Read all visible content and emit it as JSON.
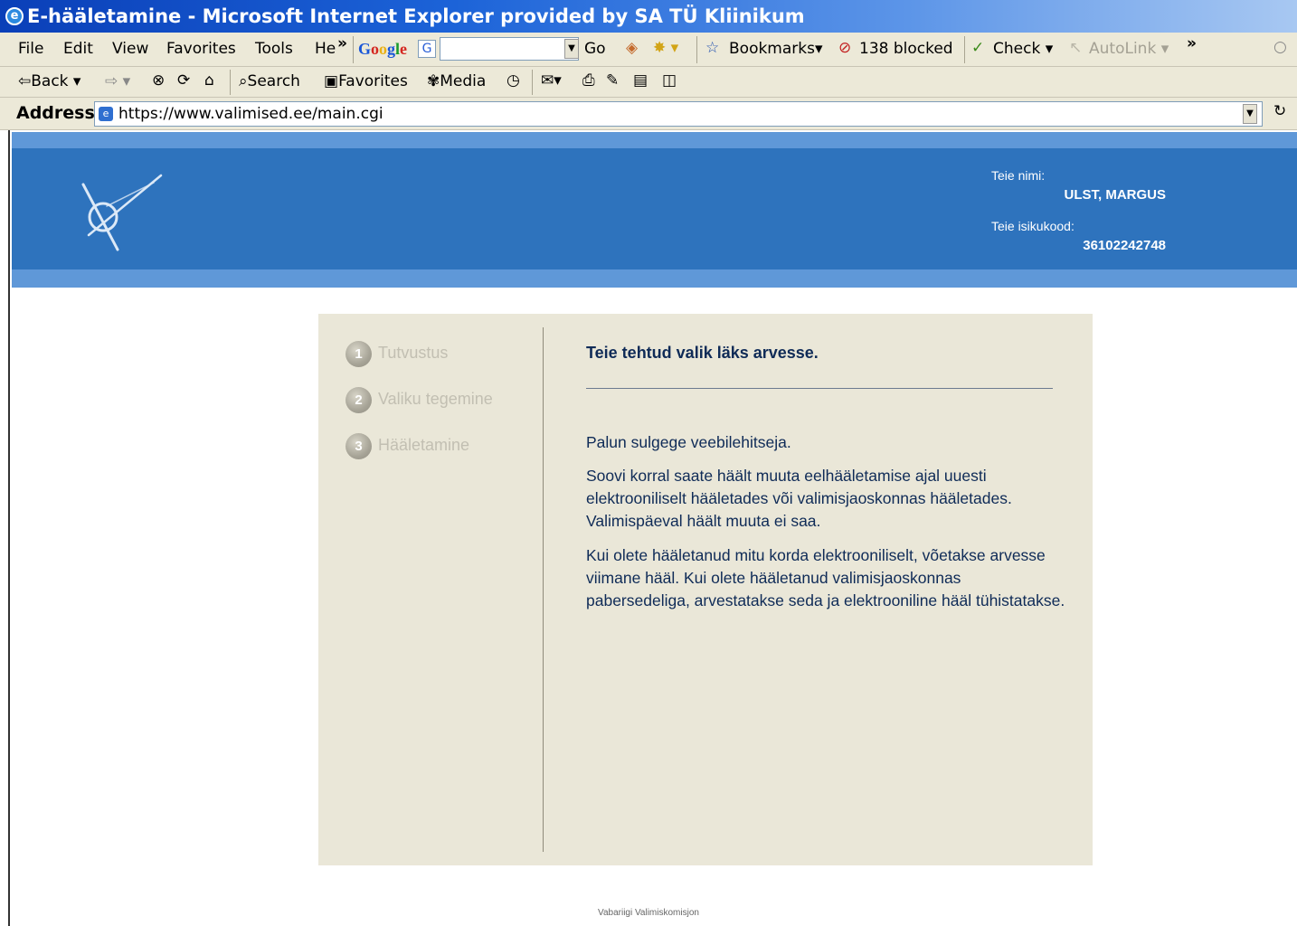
{
  "window": {
    "title": "E-hääletamine - Microsoft Internet Explorer provided by SA TÜ Kliinikum"
  },
  "menubar": {
    "items": [
      "File",
      "Edit",
      "View",
      "Favorites",
      "Tools",
      "He"
    ],
    "more": "»",
    "google_letters": [
      "G",
      "o",
      "o",
      "g",
      "l",
      "e"
    ],
    "g_button": "G",
    "go_label": "Go",
    "bookmarks_label": "Bookmarks",
    "blocked_label": "138 blocked",
    "check_label": "Check",
    "autolink_label": "AutoLink",
    "more2": "»"
  },
  "navbar": {
    "back_label": "Back",
    "search_label": "Search",
    "favorites_label": "Favorites",
    "media_label": "Media"
  },
  "addressbar": {
    "label": "Address",
    "url": "https://www.valimised.ee/main.cgi"
  },
  "header": {
    "name_label": "Teie nimi:",
    "name_value": "ULST, MARGUS",
    "id_label": "Teie isikukood:",
    "id_value": "36102242748"
  },
  "steps": [
    {
      "num": "1",
      "label": "Tutvustus"
    },
    {
      "num": "2",
      "label": "Valiku tegemine"
    },
    {
      "num": "3",
      "label": "Hääletamine"
    }
  ],
  "content": {
    "heading": "Teie tehtud valik läks arvesse.",
    "p1": "Palun sulgege veebilehitseja.",
    "p2": "Soovi korral saate häält muuta eelhääletamise ajal uuesti elektrooniliselt hääletades või valimisjaoskonnas hääletades. Valimispäeval häält muuta ei saa.",
    "p3": "Kui olete hääletanud mitu korda elektrooniliselt, võetakse arvesse viimane hääl. Kui olete hääletanud valimisjaoskonnas pabersedeliga, arvestatakse seda ja elektrooniline hääl tühistatakse."
  },
  "footer": {
    "text": "Vabariigi Valimiskomisjon"
  },
  "colors": {
    "header_blue": "#2e73bd",
    "header_light": "#5f98d8",
    "panel_bg": "#eae7d8",
    "text_dark": "#0f2b57"
  }
}
